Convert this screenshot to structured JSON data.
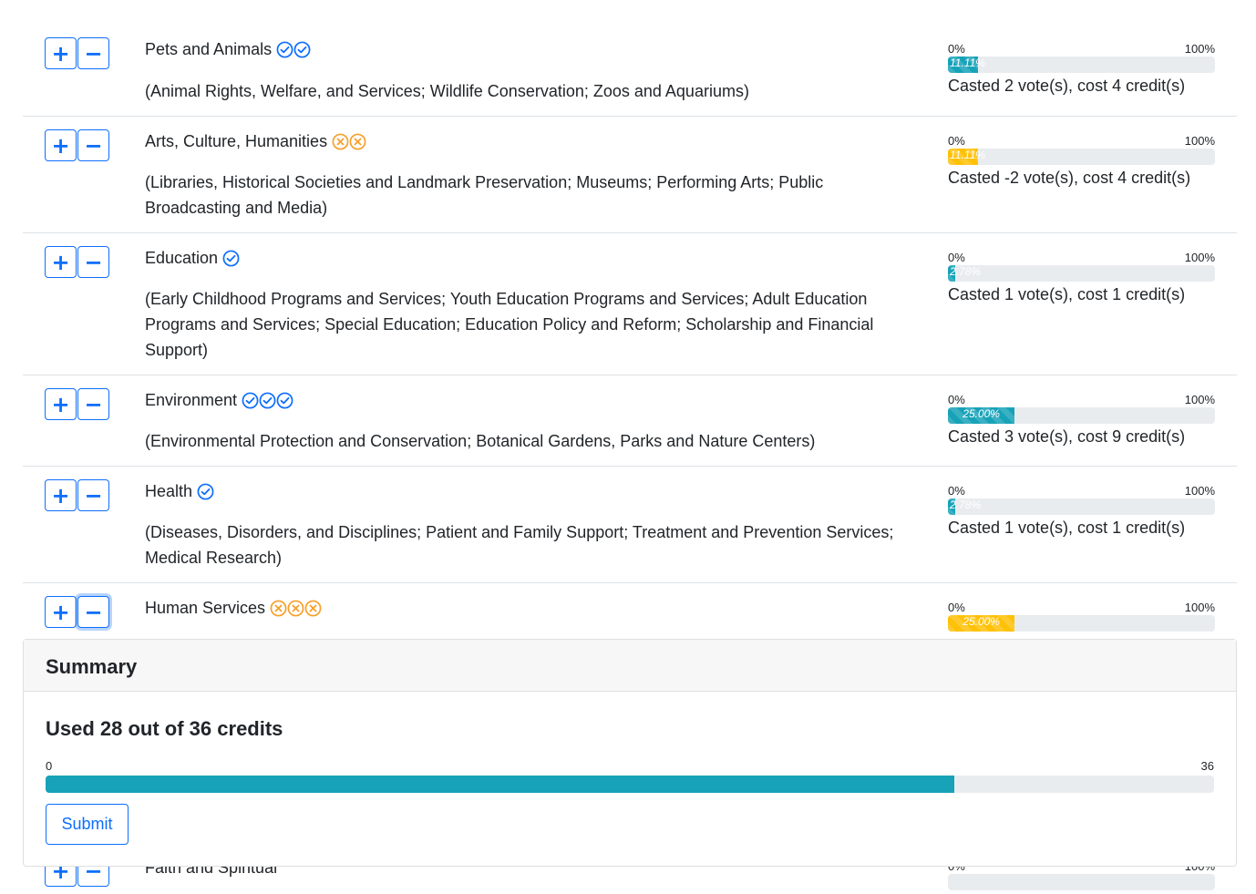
{
  "colors": {
    "accent": "#0d6efd",
    "teal": "#17a2b8",
    "yellow": "#ffc107",
    "orange": "#f8a02b"
  },
  "buttons": {
    "plus": "+",
    "minus": "−"
  },
  "meter": {
    "min_label": "0%",
    "max_label": "100%"
  },
  "items": [
    {
      "name": "Pets and Animals",
      "marks": [
        "check",
        "check"
      ],
      "desc": "(Animal Rights, Welfare, and Services; Wildlife Conservation; Zoos and Aquariums)",
      "percent": 11.11,
      "percent_label": "11.11%",
      "bar_color": "teal",
      "cost": "Casted 2 vote(s), cost 4 credit(s)"
    },
    {
      "name": "Arts, Culture, Humanities",
      "marks": [
        "x",
        "x"
      ],
      "desc": "(Libraries, Historical Societies and Landmark Preservation; Museums; Performing Arts; Public Broadcasting and Media)",
      "percent": 11.11,
      "percent_label": "11.11%",
      "bar_color": "yellow",
      "cost": "Casted -2 vote(s), cost 4 credit(s)"
    },
    {
      "name": "Education",
      "marks": [
        "check"
      ],
      "desc": "(Early Childhood Programs and Services; Youth Education Programs and Services; Adult Education Programs and Services; Special Education; Education Policy and Reform; Scholarship and Financial Support)",
      "percent": 2.78,
      "percent_label": "2.78%",
      "bar_color": "teal",
      "cost": "Casted 1 vote(s), cost 1 credit(s)"
    },
    {
      "name": "Environment",
      "marks": [
        "check",
        "check",
        "check"
      ],
      "desc": "(Environmental Protection and Conservation; Botanical Gardens, Parks and Nature Centers)",
      "percent": 25.0,
      "percent_label": "25.00%",
      "bar_color": "teal",
      "cost": "Casted 3 vote(s), cost 9 credit(s)"
    },
    {
      "name": "Health",
      "marks": [
        "check"
      ],
      "desc": "(Diseases, Disorders, and Disciplines; Patient and Family Support; Treatment and Prevention Services; Medical Research)",
      "percent": 2.78,
      "percent_label": "2.78%",
      "bar_color": "teal",
      "cost": "Casted 1 vote(s), cost 1 credit(s)"
    },
    {
      "name": "Human Services",
      "marks": [
        "x",
        "x",
        "x"
      ],
      "desc": "",
      "percent": 25.0,
      "percent_label": "25.00%",
      "bar_color": "yellow",
      "cost": ""
    },
    {
      "name": "Faith and Spiritual",
      "marks": [],
      "desc": "",
      "percent": 0,
      "percent_label": "",
      "bar_color": "teal",
      "cost": ""
    }
  ],
  "summary": {
    "title": "Summary",
    "used_text": "Used 28 out of 36 credits",
    "used": 28,
    "total": 36,
    "min_label": "0",
    "max_label": "36",
    "submit_label": "Submit"
  }
}
